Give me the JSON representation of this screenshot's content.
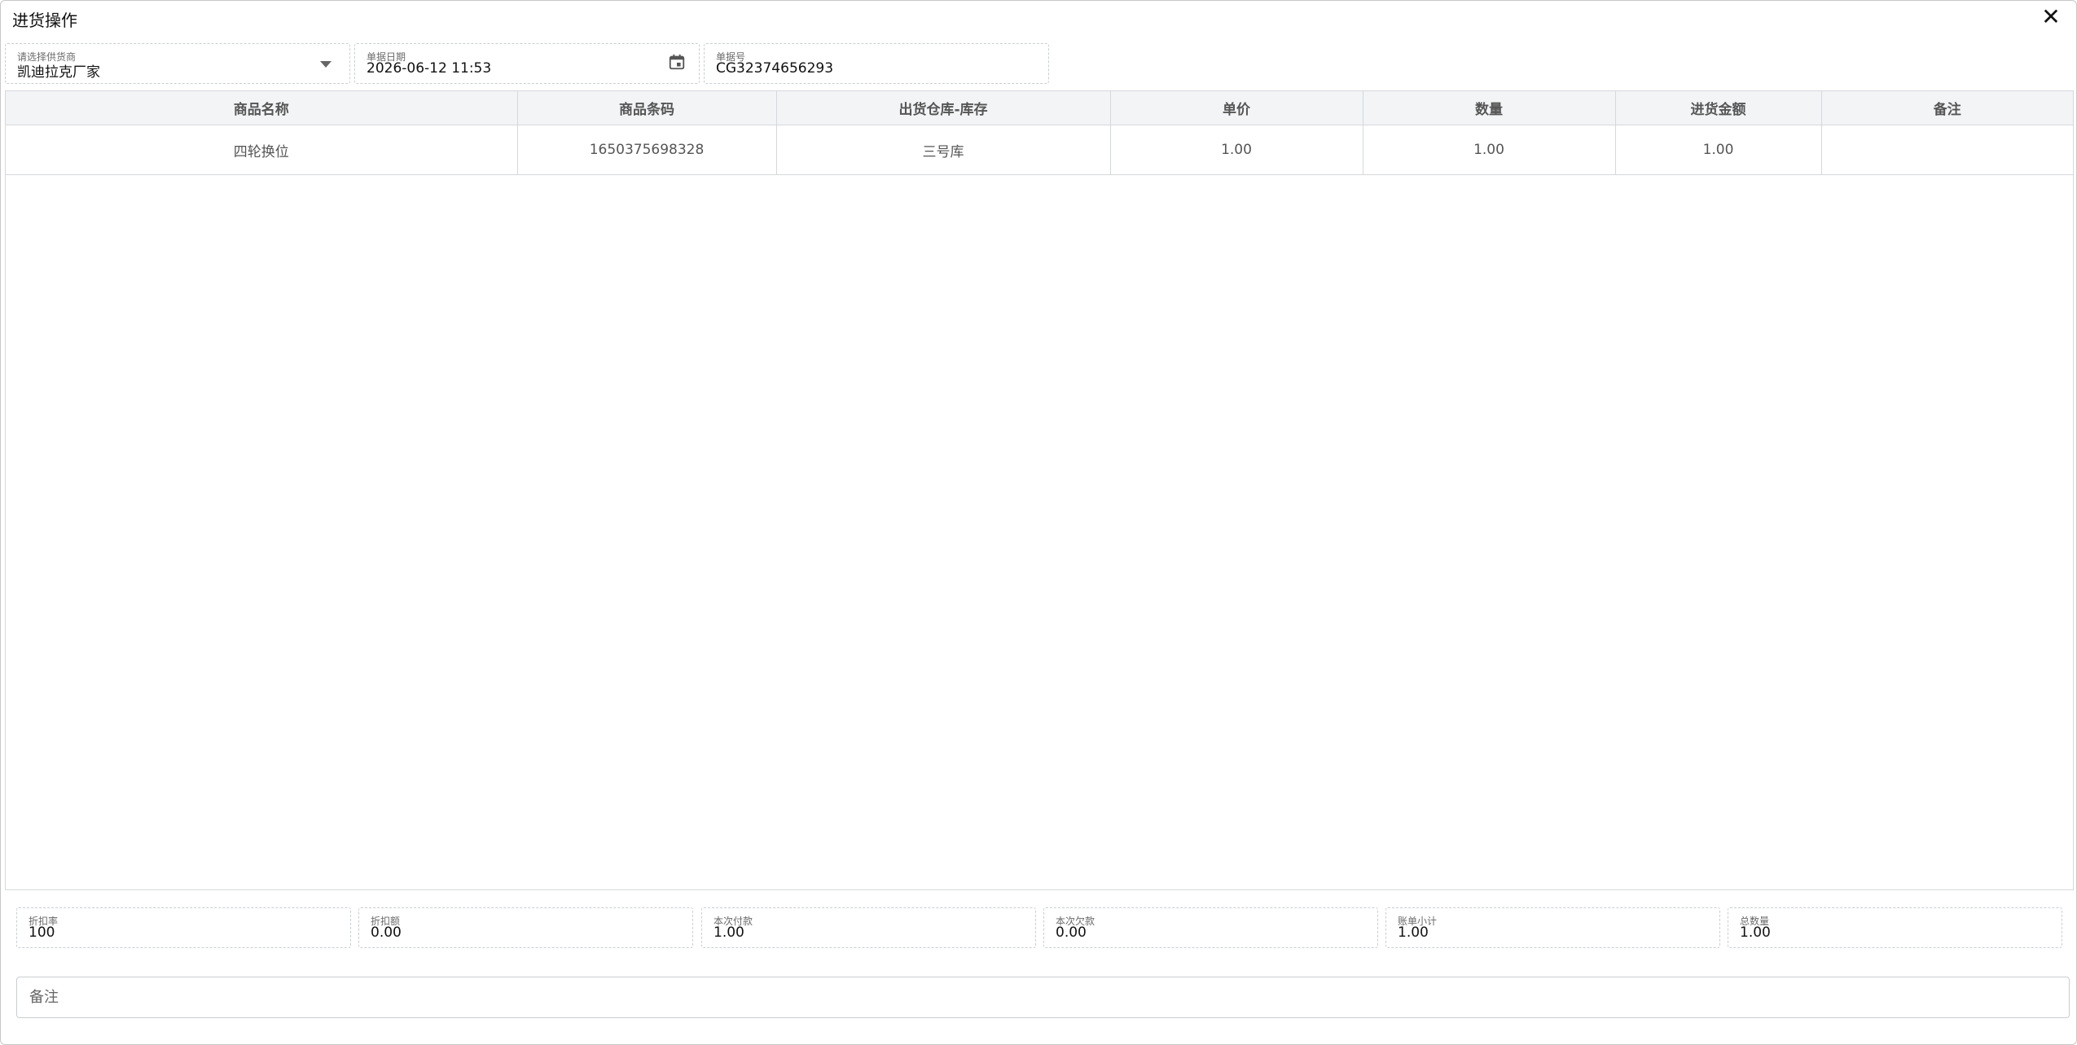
{
  "dialog": {
    "title": "进货操作",
    "close_icon": "close-icon"
  },
  "header": {
    "supplier": {
      "label": "请选择供货商",
      "value": "凯迪拉克厂家"
    },
    "date": {
      "label": "单据日期",
      "value": "2026-06-12 11:53"
    },
    "doc_no": {
      "label": "单据号",
      "value": "CG32374656293"
    }
  },
  "table": {
    "columns": [
      "商品名称",
      "商品条码",
      "出货仓库-库存",
      "单价",
      "数量",
      "进货金额",
      "备注"
    ],
    "rows": [
      [
        "四轮换位",
        "1650375698328",
        "三号库",
        "1.00",
        "1.00",
        "1.00",
        ""
      ]
    ]
  },
  "summary": [
    {
      "label": "折扣率",
      "value": "100"
    },
    {
      "label": "折扣额",
      "value": "0.00"
    },
    {
      "label": "本次付款",
      "value": "1.00"
    },
    {
      "label": "本次欠款",
      "value": "0.00"
    },
    {
      "label": "账单小计",
      "value": "1.00"
    },
    {
      "label": "总数量",
      "value": "1.00"
    }
  ],
  "remark": {
    "placeholder": "备注"
  }
}
